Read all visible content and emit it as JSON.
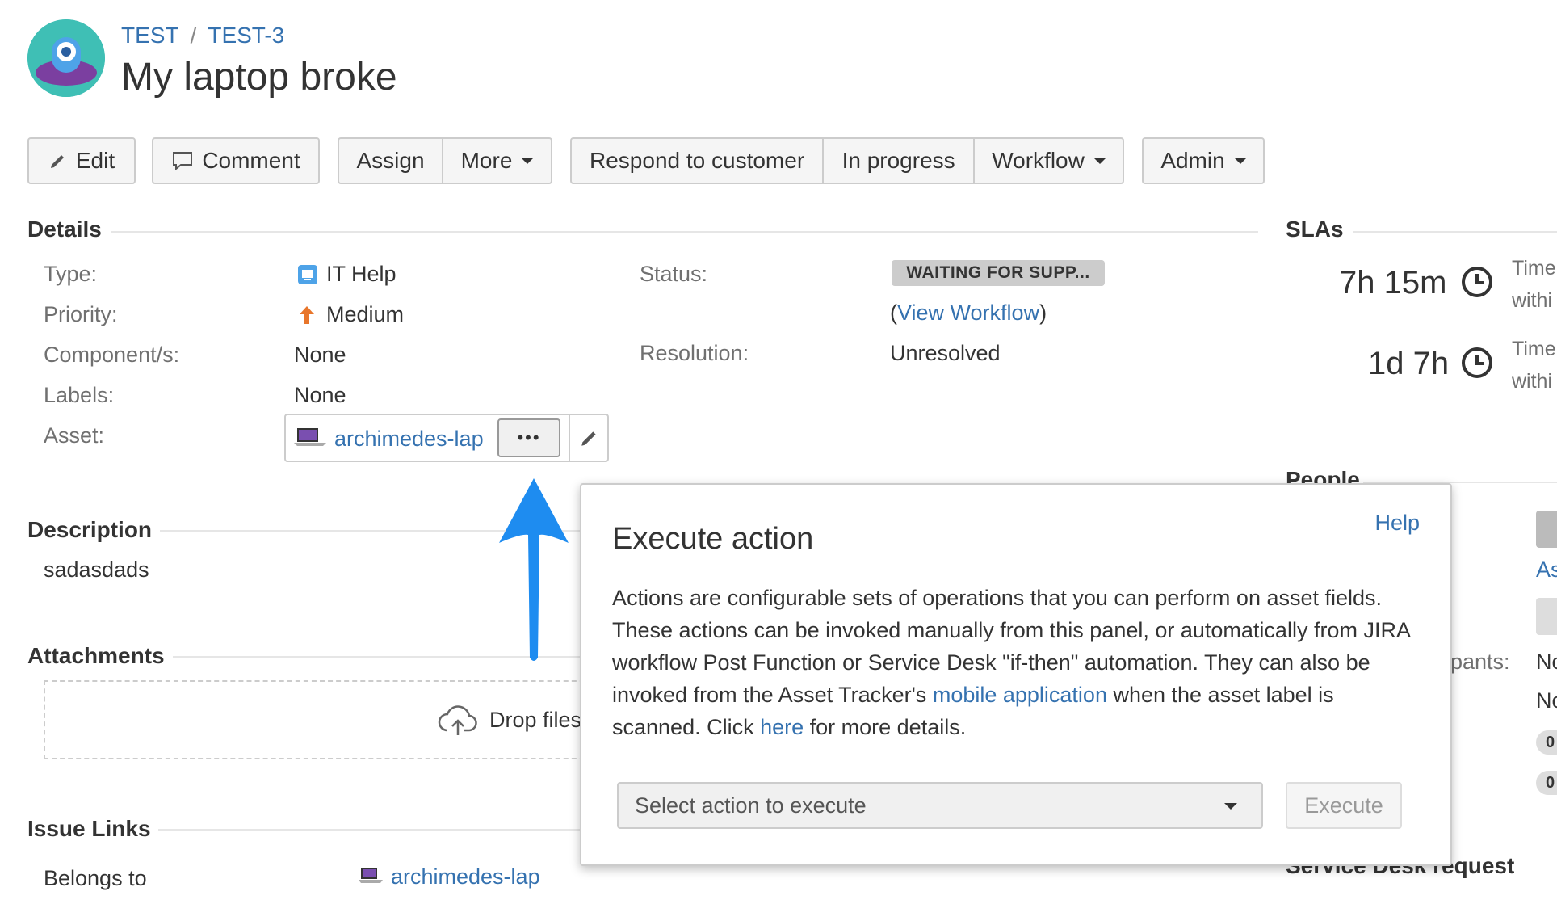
{
  "header": {
    "project": "TEST",
    "separator": "/",
    "issue_key": "TEST-3",
    "title": "My laptop broke"
  },
  "toolbar": {
    "edit": "Edit",
    "comment": "Comment",
    "assign": "Assign",
    "more": "More",
    "respond": "Respond to customer",
    "in_progress": "In progress",
    "workflow": "Workflow",
    "admin": "Admin"
  },
  "details": {
    "heading": "Details",
    "type_label": "Type:",
    "type_value": "IT Help",
    "priority_label": "Priority:",
    "priority_value": "Medium",
    "component_label": "Component/s:",
    "component_value": "None",
    "labels_label": "Labels:",
    "labels_value": "None",
    "asset_label": "Asset:",
    "asset_value": "archimedes-lap",
    "asset_more": "•••",
    "status_label": "Status:",
    "status_value": "WAITING FOR SUPP...",
    "view_workflow_open": "(",
    "view_workflow": "View Workflow",
    "view_workflow_close": ")",
    "resolution_label": "Resolution:",
    "resolution_value": "Unresolved"
  },
  "description": {
    "heading": "Description",
    "text": "sadasdads"
  },
  "attachments": {
    "heading": "Attachments",
    "drop_text": "Drop files"
  },
  "issue_links": {
    "heading": "Issue Links",
    "relation": "Belongs to",
    "target": "archimedes-lap"
  },
  "slas": {
    "heading": "SLAs",
    "items": [
      {
        "time": "7h 15m",
        "note_line1": "Time",
        "note_line2": "withi"
      },
      {
        "time": "1d 7h",
        "note_line1": "Time",
        "note_line2": "withi"
      }
    ]
  },
  "people": {
    "heading": "People",
    "assignee_partial": "As",
    "participants_partial": "pants:",
    "value_partial_1": "No",
    "value_partial_2": "No",
    "count_1": "0",
    "count_2": "0"
  },
  "service_desk": {
    "heading_partial": "Service Desk request"
  },
  "popup": {
    "title": "Execute action",
    "help": "Help",
    "text_part1": "Actions are configurable sets of operations that you can perform on asset fields. These actions can be invoked manually from this panel, or automatically from JIRA workflow Post Function or Service Desk \"if-then\" automation. They can also be invoked from the Asset Tracker's ",
    "link_mobile": "mobile application",
    "text_part2": " when the asset label is scanned. Click ",
    "link_here": "here",
    "text_part3": " for more details.",
    "select_placeholder": "Select action to execute",
    "execute_button": "Execute"
  },
  "colors": {
    "link": "#3572b0",
    "arrow": "#1e8cf0",
    "avatar_bg": "#3fbfb5",
    "priority_arrow": "#e8762b"
  }
}
